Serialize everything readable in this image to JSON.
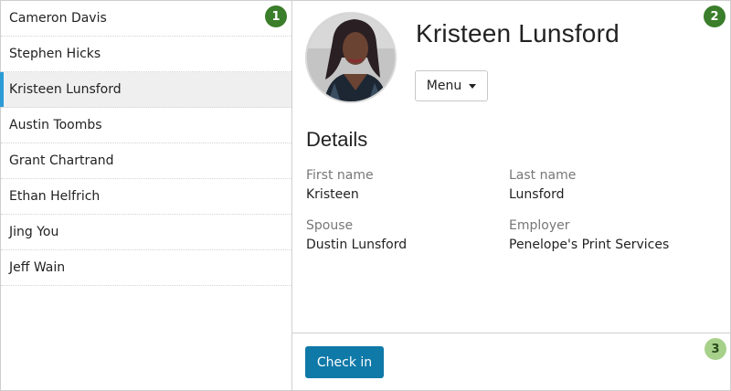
{
  "sidebar": {
    "items": [
      {
        "label": "Cameron Davis"
      },
      {
        "label": "Stephen Hicks"
      },
      {
        "label": "Kristeen Lunsford"
      },
      {
        "label": "Austin Toombs"
      },
      {
        "label": "Grant Chartrand"
      },
      {
        "label": "Ethan Helfrich"
      },
      {
        "label": "Jing You"
      },
      {
        "label": "Jeff Wain"
      }
    ],
    "selected_index": 2
  },
  "badges": {
    "one": "1",
    "two": "2",
    "three": "3"
  },
  "detail": {
    "name": "Kristeen Lunsford",
    "menu_label": "Menu",
    "section_title": "Details",
    "fields": {
      "first_name_label": "First name",
      "first_name_value": "Kristeen",
      "last_name_label": "Last name",
      "last_name_value": "Lunsford",
      "spouse_label": "Spouse",
      "spouse_value": "Dustin Lunsford",
      "employer_label": "Employer",
      "employer_value": "Penelope's Print Services"
    }
  },
  "footer": {
    "checkin_label": "Check in"
  },
  "colors": {
    "accent": "#2b9bd6",
    "primary_button": "#0f79a8",
    "badge_dark": "#3a7d2a",
    "badge_light": "#a7d18a"
  },
  "icons": {
    "menu": "caret-down-icon"
  }
}
